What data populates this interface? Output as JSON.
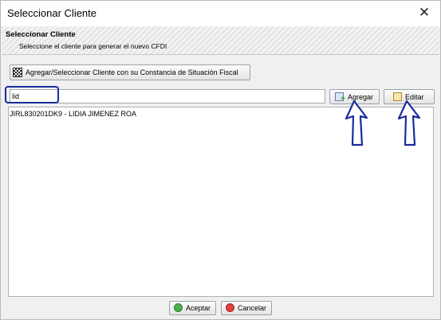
{
  "window": {
    "title": "Seleccionar Cliente",
    "close_glyph": "✕"
  },
  "header": {
    "title": "Seleccionar Cliente",
    "subtitle": "Seleccione el cliente para generar el nuevo CFDI"
  },
  "sat_button": {
    "label": "Agregar/Seleccionar Cliente con su Constancia de Situación Fiscal",
    "icon": "qr-code-icon"
  },
  "search": {
    "value": "lid",
    "placeholder": ""
  },
  "buttons": {
    "add_label": "Agregar",
    "edit_label": "Editar",
    "ok_label": "Aceptar",
    "cancel_label": "Cancelar"
  },
  "results": [
    {
      "label": "JIRL830201DK9 - LIDIA JIMENEZ ROA"
    }
  ],
  "colors": {
    "highlight": "#1a2c9b",
    "arrow": "#1a2c9b"
  }
}
